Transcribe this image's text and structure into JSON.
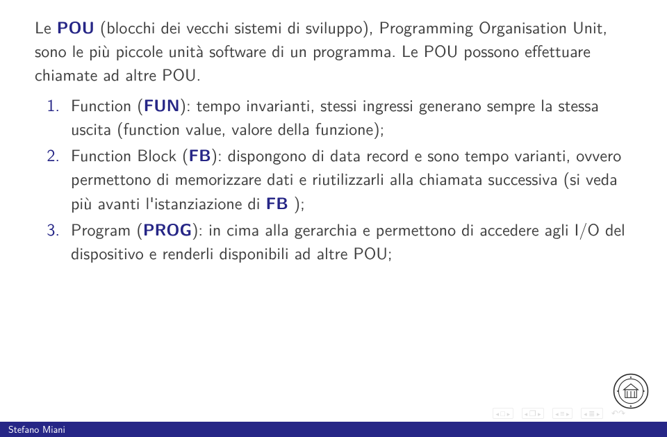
{
  "intro": {
    "p1_a": "Le ",
    "p1_b": "POU",
    "p1_c": " (blocchi dei vecchi sistemi di sviluppo), Programming Organisation Unit, sono le più piccole unità software di un programma. Le POU possono effettuare chiamate ad altre POU."
  },
  "items": [
    {
      "lead": "Function (",
      "bold": "FUN",
      "rest": "): tempo invarianti, stessi ingressi generano sempre la stessa uscita (function value, valore della funzione);"
    },
    {
      "lead": "Function Block (",
      "bold": "FB",
      "rest": "): dispongono di data record e sono tempo varianti, ovvero permettono di memorizzare dati e riutilizzarli alla chiamata successiva (si veda più avanti l'istanziazione di ",
      "bold2": "FB",
      "tail": " );"
    },
    {
      "lead": "Program (",
      "bold": "PROG",
      "rest": "): in cima alla gerarchia e permettono di accedere agli I/O del dispositivo e renderli disponibili ad altre POU;"
    }
  ],
  "footer": {
    "author": "Stefano Miani"
  },
  "nav": {
    "l": "◂",
    "r": "▸",
    "slide": "□",
    "frame": "❐",
    "sec": "≡",
    "doc": "≣",
    "back": "↶",
    "fwd": "↷"
  }
}
